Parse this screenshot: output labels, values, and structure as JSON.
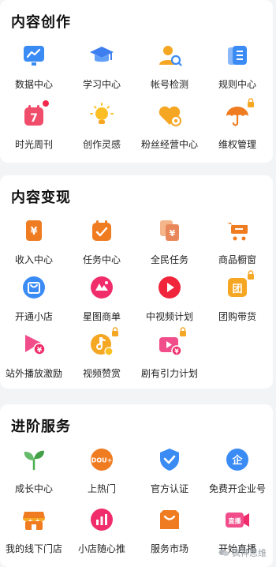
{
  "sections": [
    {
      "title": "内容创作",
      "items": [
        {
          "label": "数据中心",
          "icon": "data-center-icon"
        },
        {
          "label": "学习中心",
          "icon": "graduation-cap-icon"
        },
        {
          "label": "帐号检测",
          "icon": "account-check-icon"
        },
        {
          "label": "规则中心",
          "icon": "rules-book-icon"
        },
        {
          "label": "时光周刊",
          "icon": "calendar-7-icon",
          "badge": "red-dot"
        },
        {
          "label": "创作灵感",
          "icon": "lightbulb-icon"
        },
        {
          "label": "粉丝经营中心",
          "icon": "heart-gear-icon"
        },
        {
          "label": "维权管理",
          "icon": "umbrella-icon",
          "locked": true
        }
      ]
    },
    {
      "title": "内容变现",
      "items": [
        {
          "label": "收入中心",
          "icon": "yen-card-icon"
        },
        {
          "label": "任务中心",
          "icon": "task-calendar-icon"
        },
        {
          "label": "全民任务",
          "icon": "yen-coins-icon"
        },
        {
          "label": "商品橱窗",
          "icon": "shopping-cart-icon"
        },
        {
          "label": "开通小店",
          "icon": "shop-bag-icon"
        },
        {
          "label": "星图商单",
          "icon": "star-map-icon"
        },
        {
          "label": "中视频计划",
          "icon": "play-circle-icon"
        },
        {
          "label": "团购带货",
          "icon": "group-buy-icon",
          "locked": true
        },
        {
          "label": "站外播放激励",
          "icon": "play-yen-icon"
        },
        {
          "label": "视频赞赏",
          "icon": "music-coin-icon",
          "locked": true
        },
        {
          "label": "剧有引力计划",
          "icon": "tv-yen-icon",
          "locked": true
        }
      ]
    },
    {
      "title": "进阶服务",
      "items": [
        {
          "label": "成长中心",
          "icon": "sprout-icon"
        },
        {
          "label": "上热门",
          "icon": "dou-plus-icon"
        },
        {
          "label": "官方认证",
          "icon": "verified-shield-icon"
        },
        {
          "label": "免费开企业号",
          "icon": "enterprise-icon"
        },
        {
          "label": "我的线下门店",
          "icon": "storefront-icon"
        },
        {
          "label": "小店随心推",
          "icon": "chart-bars-icon"
        },
        {
          "label": "服务市场",
          "icon": "service-market-icon"
        },
        {
          "label": "开始直播",
          "icon": "live-camera-icon"
        }
      ]
    }
  ],
  "watermark": "疯神思维",
  "colors": {
    "background": "#f3f4f6",
    "card": "#ffffff",
    "badge": "#f2274a",
    "lock": "#f5a623"
  }
}
